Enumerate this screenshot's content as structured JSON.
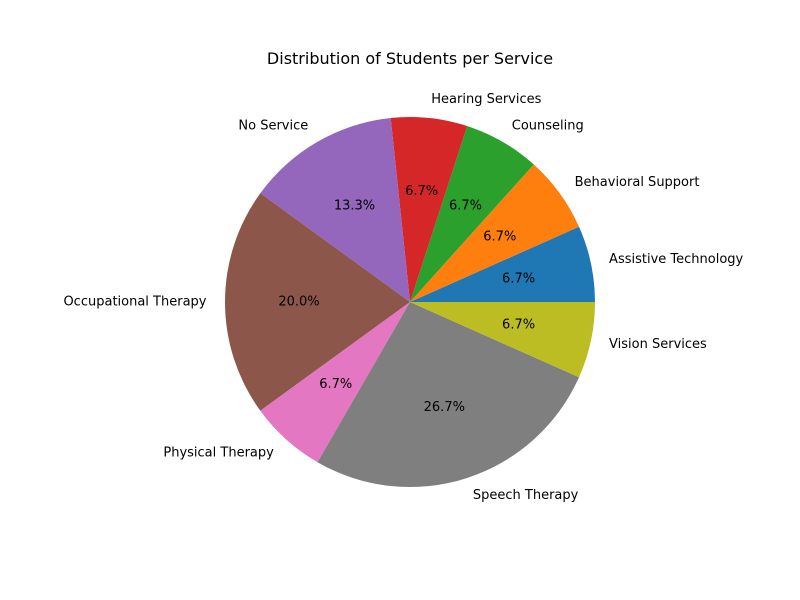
{
  "chart_data": {
    "type": "pie",
    "title": "Distribution of Students per Service",
    "categories": [
      "Assistive Technology",
      "Behavioral Support",
      "Counseling",
      "Hearing Services",
      "No Service",
      "Occupational Therapy",
      "Physical Therapy",
      "Speech Therapy",
      "Vision Services"
    ],
    "values": [
      1,
      1,
      1,
      1,
      2,
      3,
      1,
      4,
      1
    ],
    "percent_labels": [
      "6.7%",
      "6.7%",
      "6.7%",
      "6.7%",
      "13.3%",
      "20.0%",
      "6.7%",
      "26.7%",
      "6.7%"
    ],
    "colors": [
      "#1f77b4",
      "#ff7f0e",
      "#2ca02c",
      "#d62728",
      "#9467bd",
      "#8c564b",
      "#e377c2",
      "#7f7f7f",
      "#bcbd22"
    ],
    "start_angle_deg": 0,
    "direction": "counterclockwise"
  }
}
